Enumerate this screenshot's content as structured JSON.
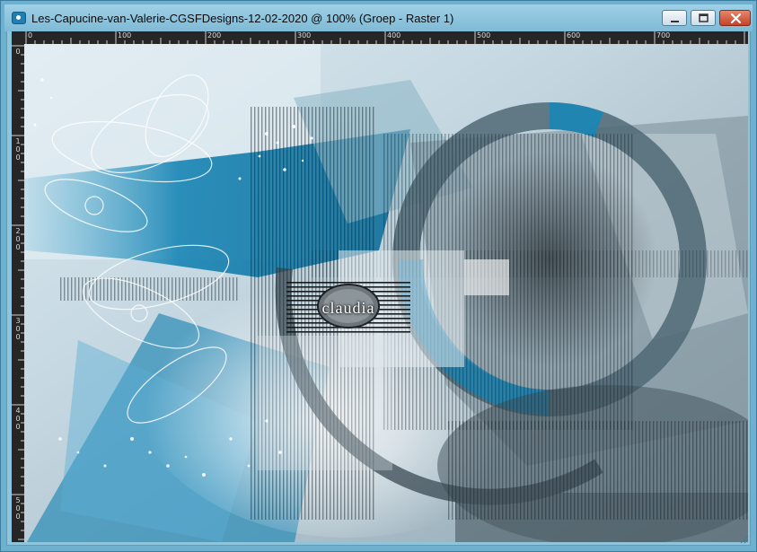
{
  "window": {
    "title": "Les-Capucine-van-Valerie-CGSFDesigns-12-02-2020 @ 100% (Groep - Raster 1)",
    "app_icon": "camera-icon",
    "buttons": [
      "minimize-icon",
      "maximize-icon",
      "close-icon"
    ],
    "accent_color": "#7fbad6",
    "close_color": "#c5432a"
  },
  "rulers": {
    "top_labels": [
      "0",
      "100",
      "200",
      "300",
      "400",
      "500",
      "600",
      "700"
    ],
    "left_labels": [
      "0",
      "1 0 0",
      "2 0 0",
      "3 0 0",
      "4 0 0",
      "5 0 0"
    ],
    "background_color": "#262626"
  },
  "canvas": {
    "watermark_text": "claudia",
    "dominant_colors": [
      "#1a8ab8",
      "#b7cfdb",
      "#5d6e78",
      "#2a2f33"
    ]
  }
}
